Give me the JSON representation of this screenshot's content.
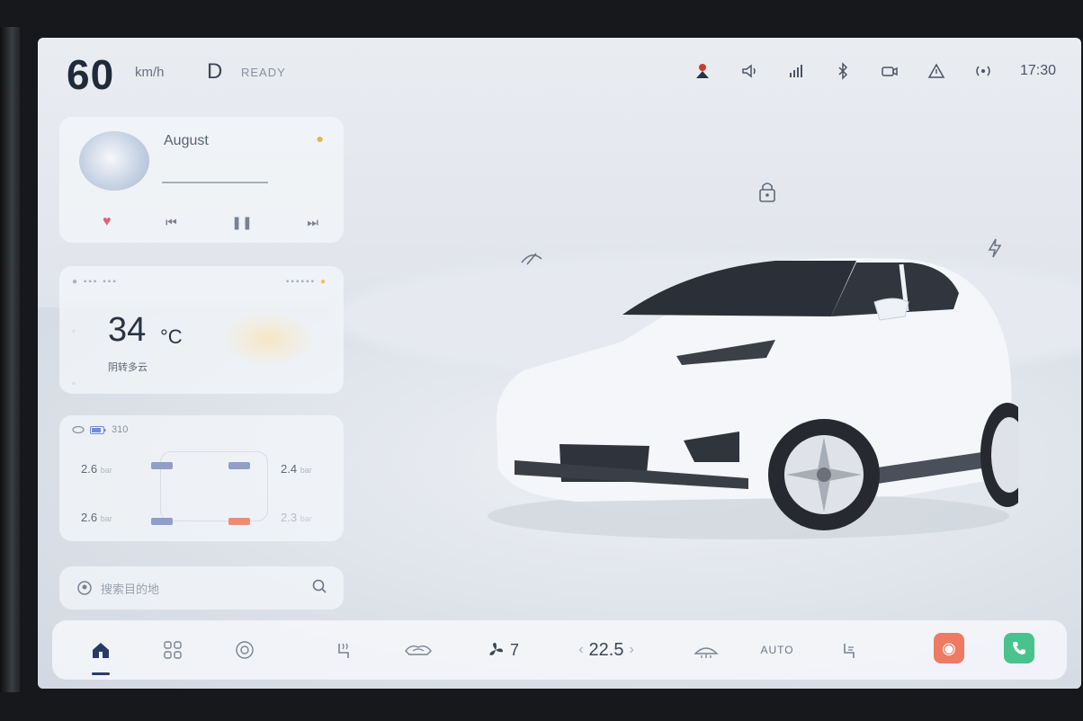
{
  "status": {
    "speed": "60",
    "speed_unit": "km/h",
    "gear": "D",
    "gear_status": "READY",
    "time": "17:30",
    "icons": [
      "driver-alert-icon",
      "speaker-icon",
      "signal-icon",
      "bluetooth-icon",
      "dashcam-icon",
      "warning-icon",
      "wifi-icon"
    ]
  },
  "music": {
    "title": "August",
    "controls": [
      "heart-icon",
      "previous-icon",
      "pause-icon",
      "next-icon"
    ]
  },
  "weather": {
    "temperature": "34",
    "unit": "°C",
    "subtitle": "阴转多云"
  },
  "tyres": {
    "header": "310",
    "front_left": "2.6",
    "front_right": "2.4",
    "rear_left": "2.6",
    "rear_right": "2.3",
    "unit_suffix": "bar",
    "colors": {
      "ok": "#8f9fc9",
      "warn": "#f08b6f"
    }
  },
  "search": {
    "placeholder": "搜索目的地"
  },
  "dock": {
    "climate_temp": "22.5",
    "fan_level": "7",
    "auto_label": "AUTO",
    "colors": {
      "app_orange": "#ee7a64",
      "app_green": "#49c28d",
      "home": "#2a3a66"
    }
  }
}
